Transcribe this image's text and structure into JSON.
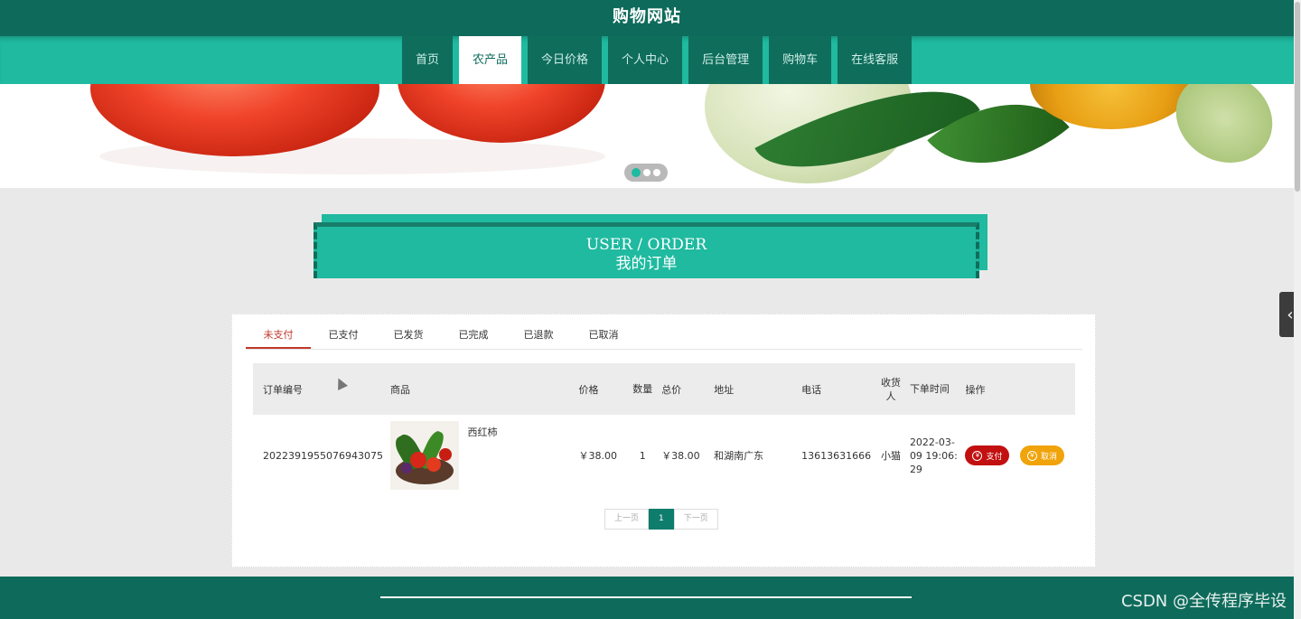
{
  "header": {
    "title": "购物网站"
  },
  "nav": [
    {
      "label": "首页",
      "active": false
    },
    {
      "label": "农产品",
      "active": true
    },
    {
      "label": "今日价格",
      "active": false
    },
    {
      "label": "个人中心",
      "active": false
    },
    {
      "label": "后台管理",
      "active": false
    },
    {
      "label": "购物车",
      "active": false
    },
    {
      "label": "在线客服",
      "active": false
    }
  ],
  "banner": {
    "slide_count": 3,
    "active_slide": 1
  },
  "section": {
    "title_en": "USER / ORDER",
    "title_cn": "我的订单"
  },
  "tabs": [
    "未支付",
    "已支付",
    "已发货",
    "已完成",
    "已退款",
    "已取消"
  ],
  "active_tab": "未支付",
  "table": {
    "headers": {
      "order_no": "订单编号",
      "product": "商品",
      "price": "价格",
      "qty": "数量",
      "total": "总价",
      "address": "地址",
      "phone": "电话",
      "receiver": "收货人",
      "time": "下单时间",
      "action": "操作"
    },
    "rows": [
      {
        "order_no": "2022391955076943075",
        "product": "西红柿",
        "price": "￥38.00",
        "qty": "1",
        "total": "￥38.00",
        "address": "和湖南广东",
        "phone": "13613631666",
        "receiver": "小猫",
        "time": "2022-03-09 19:06:29"
      }
    ]
  },
  "buttons": {
    "pay": "支付",
    "cancel": "取消",
    "currency_icon": "¥"
  },
  "pagination": {
    "prev": "上一页",
    "current": "1",
    "next": "下一页"
  },
  "watermark": "CSDN @全传程序毕设",
  "colors": {
    "primary": "#1fbaa0",
    "dark": "#0e6b5b",
    "pay": "#c21010",
    "cancel": "#f0a30a",
    "active_tab": "#c0392b"
  }
}
